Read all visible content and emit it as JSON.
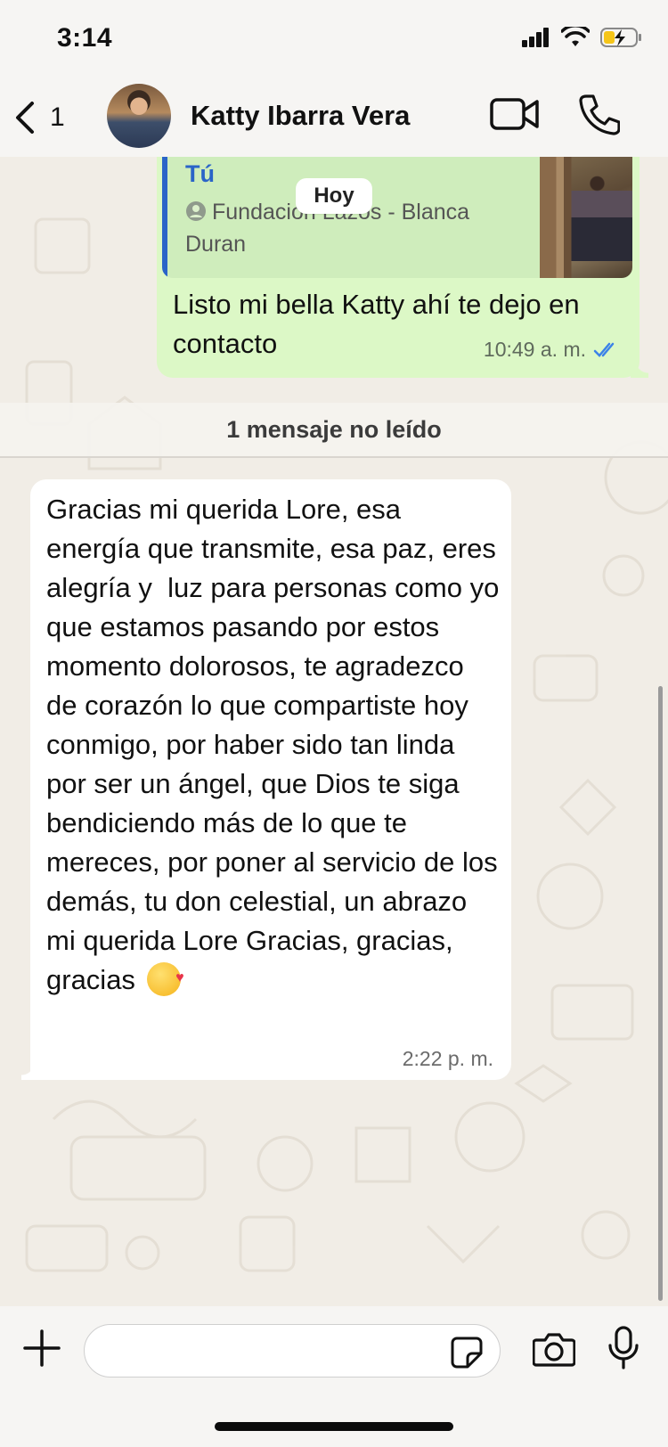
{
  "status_bar": {
    "time": "3:14"
  },
  "header": {
    "back_count": "1",
    "contact_name": "Katty Ibarra Vera"
  },
  "date_separator": "Hoy",
  "outgoing_message": {
    "quote_author": "Tú",
    "quote_text": "Fundacion Lazos - Blanca Duran",
    "text": "Listo mi bella Katty ahí te dejo en contacto",
    "time": "10:49 a. m.",
    "status": "read"
  },
  "unread_divider": "1 mensaje no leído",
  "incoming_message": {
    "text": "Gracias mi querida Lore, esa energía que transmite, esa paz, eres alegría y  luz para personas como yo que estamos pasando por estos momento dolorosos, te agradezco de corazón lo que compartiste hoy conmigo, por haber sido tan linda por ser un ángel, que Dios te siga bendiciendo más de lo que te mereces, por poner al servicio de los demás, tu don celestial, un abrazo mi querida Lore Gracias, gracias, gracias",
    "emoji": "kissing-face-with-heart",
    "time": "2:22 p. m."
  },
  "composer": {
    "placeholder": ""
  },
  "colors": {
    "outgoing_bubble": "#dcf8c6",
    "incoming_bubble": "#ffffff",
    "quote_accent": "#2a64c8",
    "read_ticks": "#3b82e8"
  }
}
